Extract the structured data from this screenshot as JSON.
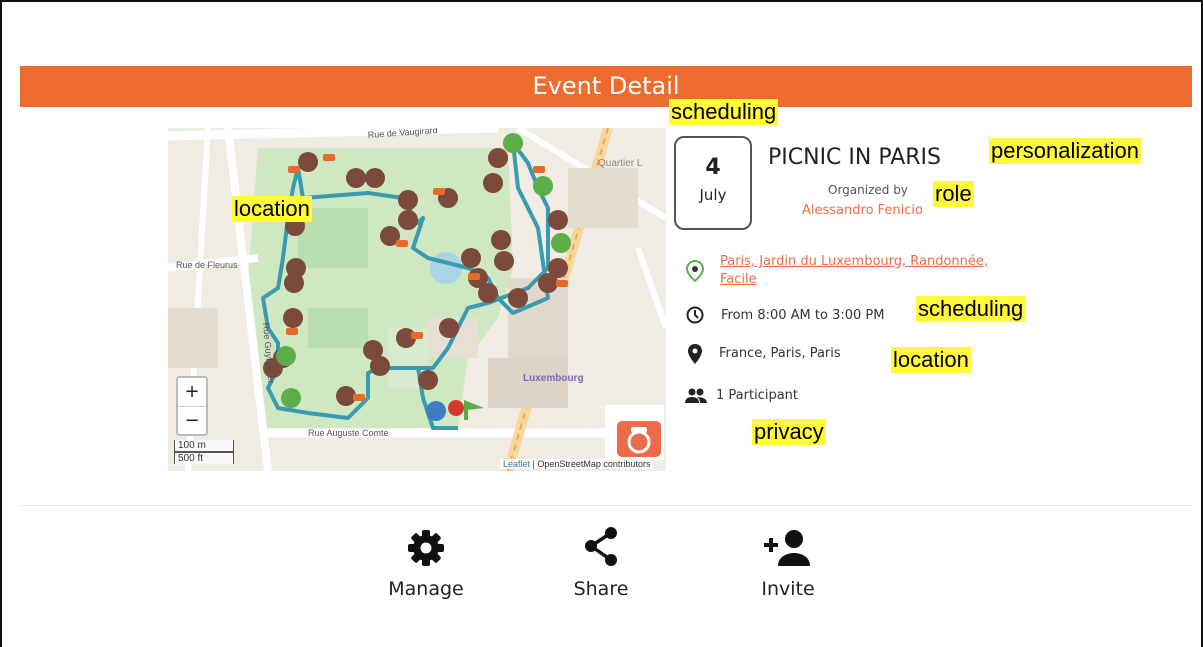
{
  "header": {
    "title": "Event Detail"
  },
  "annotations": {
    "scheduling_top": "scheduling",
    "personalization": "personalization",
    "location_map": "location",
    "role": "role",
    "scheduling_time": "scheduling",
    "location_info": "location",
    "privacy": "privacy"
  },
  "event": {
    "day": "4",
    "month": "July",
    "title": "PICNIC IN PARIS",
    "organized_by_label": "Organized by",
    "organizer": "Alessandro Fenicio",
    "route_link": "Paris, Jardin du Luxembourg, Randonnée, Facile",
    "time": "From 8:00 AM to 3:00 PM",
    "place": "France, Paris, Paris",
    "participants": "1 Participant"
  },
  "map": {
    "zoom_in": "+",
    "zoom_out": "−",
    "scale_metric": "100 m",
    "scale_imperial": "500 ft",
    "attribution_link": "Leaflet",
    "attribution_rest": "| OpenStreetMap contributors",
    "street_labels": {
      "vaugirard": "Rue de Vaugirard",
      "fleurus": "Rue de Fleurus",
      "guynemer": "Rue Guynemer",
      "auguste_comte": "Rue Auguste Comte",
      "luxembourg": "Luxembourg",
      "quartier": "Quartier L"
    },
    "accent_route": "#3a9bb0"
  },
  "actions": {
    "manage": "Manage",
    "share": "Share",
    "invite": "Invite"
  },
  "colors": {
    "accent": "#ee6b2f",
    "highlight": "#fff93a"
  }
}
